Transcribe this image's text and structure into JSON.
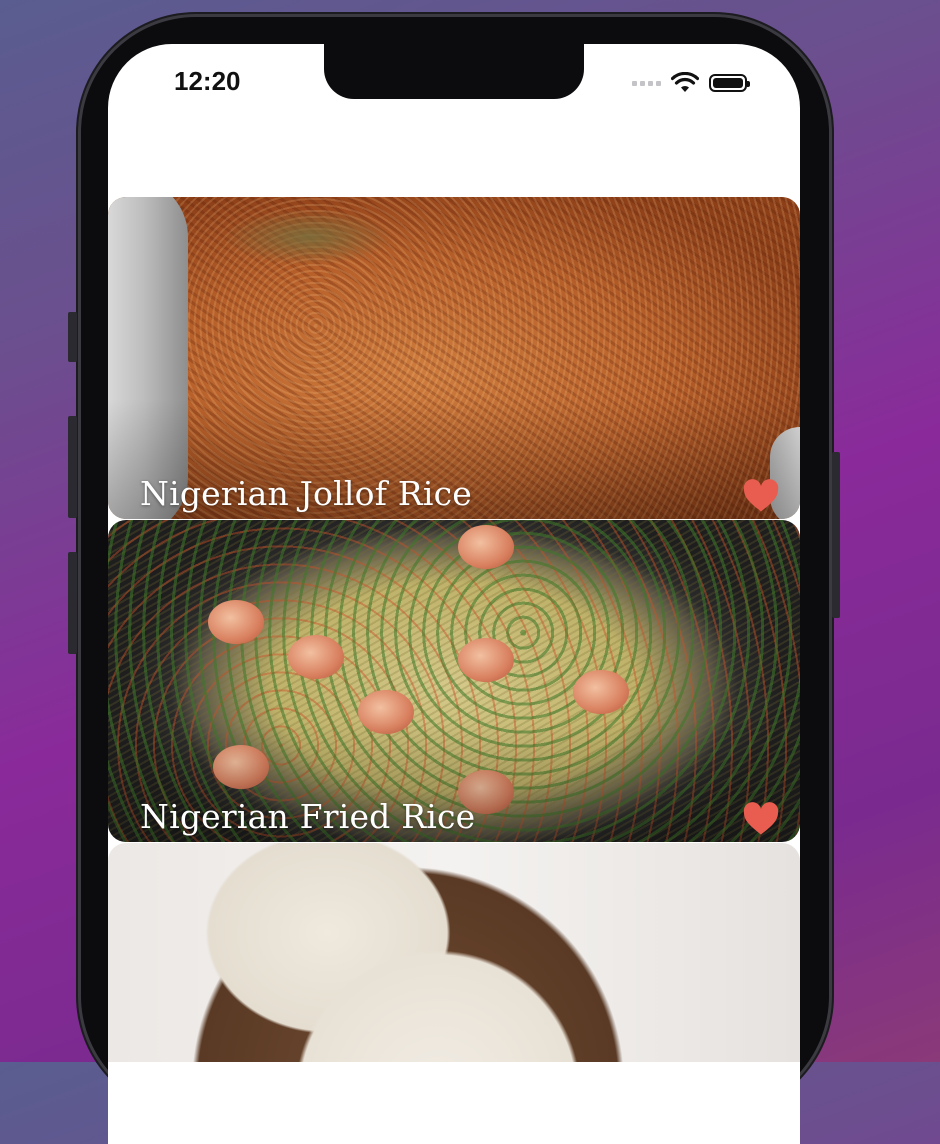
{
  "status_bar": {
    "time": "12:20",
    "icons": [
      "cellular-signal-icon",
      "wifi-icon",
      "battery-icon"
    ]
  },
  "recipes": [
    {
      "title": "Nigerian Jollof Rice",
      "favorite": true,
      "image": "jollof-rice-photo"
    },
    {
      "title": "Nigerian Fried Rice",
      "favorite": true,
      "image": "fried-rice-photo"
    },
    {
      "title": "",
      "favorite": false,
      "image": "fufu-photo"
    }
  ],
  "colors": {
    "heart": "#e85d4f",
    "title_text": "#ffffff"
  }
}
